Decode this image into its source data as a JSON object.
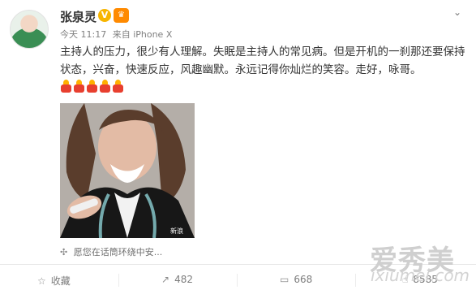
{
  "user": {
    "name": "张泉灵",
    "avatar": "avatar-image"
  },
  "post": {
    "time": "今天 11:17",
    "source": "来自 iPhone X",
    "text": "主持人的压力，很少有人理解。失眠是主持人的常见病。但是开机的一刹那还要保持状态，兴奋，快速反应，风趣幽默。永远记得你灿烂的笑容。走好，咏哥。",
    "emoji_count": 5,
    "photo_credit": "愿您在话筒环绕中安...",
    "photo_watermark": "新浪"
  },
  "actions": {
    "favorite": "收藏",
    "repost": "482",
    "comment": "668",
    "like": "8585"
  },
  "watermark": {
    "main": "爱秀美",
    "sub": "ixiumei.com"
  },
  "colors": {
    "text": "#333333",
    "meta": "#808080",
    "candle_red": "#e83f2f",
    "verified": "#f7b500"
  },
  "icons": {
    "verified": "verified-v-icon",
    "member": "member-badge-icon",
    "dropdown": "chevron-down-icon",
    "location": "location-icon",
    "favorite": "star-icon",
    "repost": "repost-icon",
    "comment": "comment-icon",
    "like": "thumbs-up-icon"
  }
}
